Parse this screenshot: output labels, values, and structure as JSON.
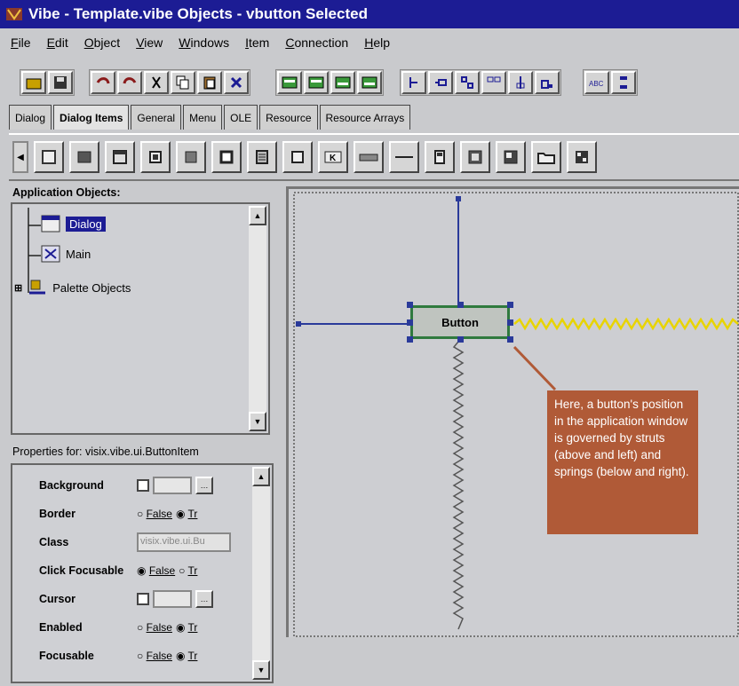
{
  "window": {
    "title": "Vibe - Template.vibe Objects - vbutton Selected"
  },
  "menubar": {
    "items": [
      "File",
      "Edit",
      "Object",
      "View",
      "Windows",
      "Item",
      "Connection",
      "Help"
    ]
  },
  "tabs": [
    "Dialog",
    "Dialog Items",
    "General",
    "Menu",
    "OLE",
    "Resource",
    "Resource Arrays"
  ],
  "active_tab": "Dialog Items",
  "tree": {
    "heading": "Application Objects:",
    "items": [
      {
        "label": "Dialog",
        "selected": true
      },
      {
        "label": "Main",
        "selected": false
      },
      {
        "label": "Palette Objects",
        "selected": false
      }
    ]
  },
  "properties": {
    "heading": "Properties for: visix.vibe.ui.ButtonItem",
    "rows": [
      {
        "name": "Background",
        "kind": "checkbox"
      },
      {
        "name": "Border",
        "kind": "radio",
        "false_label": "False",
        "true_label": "Tr"
      },
      {
        "name": "Class",
        "kind": "text",
        "value": "visix.vibe.ui.Bu"
      },
      {
        "name": "Click Focusable",
        "kind": "radio",
        "false_label": "False",
        "true_label": "Tr"
      },
      {
        "name": "Cursor",
        "kind": "checkbox"
      },
      {
        "name": "Enabled",
        "kind": "radio",
        "false_label": "False",
        "true_label": "Tr"
      },
      {
        "name": "Focusable",
        "kind": "radio",
        "false_label": "False",
        "true_label": "Tr"
      }
    ]
  },
  "canvas": {
    "button_label": "Button",
    "annotation": "Here, a button's position in the application window is governed by struts (above and left) and springs (below and right)."
  },
  "colors": {
    "titlebar": "#1c1c94",
    "annotation": "#b05a37",
    "spring": "#e8d400",
    "strut": "#2a3a9a"
  }
}
